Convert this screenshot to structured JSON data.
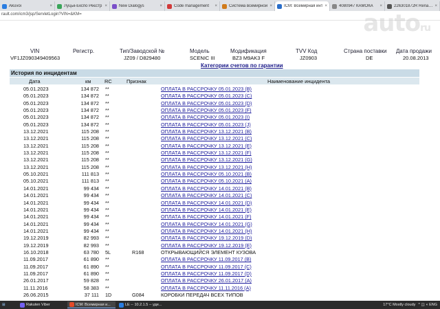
{
  "browser": {
    "tabs": [
      {
        "label": "Akuvoi",
        "color": "#2a7de1"
      },
      {
        "label": "Луцьк-Експо Реєстр",
        "color": "#3aa55a"
      },
      {
        "label": "New Dialogys",
        "color": "#7a4fc9"
      },
      {
        "label": "Code management",
        "color": "#d13a3a"
      },
      {
        "label": "Система всемирной",
        "color": "#d07a1a"
      },
      {
        "label": "ICM: Всемирная инт",
        "color": "#2a6ec9",
        "active": true
      },
      {
        "label": "4080947 КАМОКА",
        "color": "#888888"
      },
      {
        "label": "226301872R Renault",
        "color": "#555555"
      }
    ],
    "address": "rault.com/icm3/jsp/ServletLogin?VIN=&KM="
  },
  "watermark": {
    "main": "auto",
    "suffix": "ru"
  },
  "vehicle": {
    "headers": {
      "vin": "VIN",
      "reg": "Регистр.",
      "type": "Тип/Заводской №",
      "model": "Модель",
      "modification": "Модификация",
      "tvv": "TVV Код",
      "country": "Страна поставки",
      "sale_date": "Дата продажи"
    },
    "values": {
      "vin": "VF1JZ090349409563",
      "reg": "",
      "type": "JZ09 / D829480",
      "model": "SCENIC III",
      "modification": "BZ3 M9AK3 F",
      "tvv": "JZ0903",
      "country": "DE",
      "sale_date": "20.08.2013"
    }
  },
  "categories_link": "Категории счетов по гарантии",
  "history": {
    "title": "История по инцидентам",
    "columns": {
      "date": "Дата",
      "km": "км",
      "rc": "RC",
      "sign": "Признак",
      "name": "Наименование инцидента"
    },
    "rows": [
      {
        "date": "05.01.2023",
        "km": "134 872",
        "rc": "**",
        "sign": "",
        "name": "ОПЛАТА В РАССРОЧКУ 05.01.2023 (B)",
        "link": true
      },
      {
        "date": "05.01.2023",
        "km": "134 872",
        "rc": "**",
        "sign": "",
        "name": "ОПЛАТА В РАССРОЧКУ 05.01.2023 (C)",
        "link": true
      },
      {
        "date": "05.01.2023",
        "km": "134 872",
        "rc": "**",
        "sign": "",
        "name": "ОПЛАТА В РАССРОЧКУ 05.01.2023 (D)",
        "link": true
      },
      {
        "date": "05.01.2023",
        "km": "134 872",
        "rc": "**",
        "sign": "",
        "name": "ОПЛАТА В РАССРОЧКУ 05.01.2023 (F)",
        "link": true
      },
      {
        "date": "05.01.2023",
        "km": "134 872",
        "rc": "**",
        "sign": "",
        "name": "ОПЛАТА В РАССРОЧКУ 05.01.2023 (I)",
        "link": true
      },
      {
        "date": "05.01.2023",
        "km": "134 872",
        "rc": "**",
        "sign": "",
        "name": "ОПЛАТА В РАССРОЧКУ 05.01.2023 (J)",
        "link": true
      },
      {
        "date": "13.12.2021",
        "km": "115 208",
        "rc": "**",
        "sign": "",
        "name": "ОПЛАТА В РАССРОЧКУ 13.12.2021 (B)",
        "link": true
      },
      {
        "date": "13.12.2021",
        "km": "115 208",
        "rc": "**",
        "sign": "",
        "name": "ОПЛАТА В РАССРОЧКУ 13.12.2021 (C)",
        "link": true
      },
      {
        "date": "13.12.2021",
        "km": "115 208",
        "rc": "**",
        "sign": "",
        "name": "ОПЛАТА В РАССРОЧКУ 13.12.2021 (E)",
        "link": true
      },
      {
        "date": "13.12.2021",
        "km": "115 208",
        "rc": "**",
        "sign": "",
        "name": "ОПЛАТА В РАССРОЧКУ 13.12.2021 (F)",
        "link": true
      },
      {
        "date": "13.12.2021",
        "km": "115 208",
        "rc": "**",
        "sign": "",
        "name": "ОПЛАТА В РАССРОЧКУ 13.12.2021 (G)",
        "link": true
      },
      {
        "date": "13.12.2021",
        "km": "115 208",
        "rc": "**",
        "sign": "",
        "name": "ОПЛАТА В РАССРОЧКУ 13.12.2021 (H)",
        "link": true
      },
      {
        "date": "05.10.2021",
        "km": "111 813",
        "rc": "**",
        "sign": "",
        "name": "ОПЛАТА В РАССРОЧКУ 05.10.2021 (B)",
        "link": true
      },
      {
        "date": "05.10.2021",
        "km": "111 813",
        "rc": "**",
        "sign": "",
        "name": "ОПЛАТА В РАССРОЧКУ 05.10.2021 (A)",
        "link": true
      },
      {
        "date": "14.01.2021",
        "km": "99 434",
        "rc": "**",
        "sign": "",
        "name": "ОПЛАТА В РАССРОЧКУ 14.01.2021 (B)",
        "link": true
      },
      {
        "date": "14.01.2021",
        "km": "99 434",
        "rc": "**",
        "sign": "",
        "name": "ОПЛАТА В РАССРОЧКУ 14.01.2021 (C)",
        "link": true
      },
      {
        "date": "14.01.2021",
        "km": "99 434",
        "rc": "**",
        "sign": "",
        "name": "ОПЛАТА В РАССРОЧКУ 14.01.2021 (D)",
        "link": true
      },
      {
        "date": "14.01.2021",
        "km": "99 434",
        "rc": "**",
        "sign": "",
        "name": "ОПЛАТА В РАССРОЧКУ 14.01.2021 (E)",
        "link": true
      },
      {
        "date": "14.01.2021",
        "km": "99 434",
        "rc": "**",
        "sign": "",
        "name": "ОПЛАТА В РАССРОЧКУ 14.01.2021 (F)",
        "link": true
      },
      {
        "date": "14.01.2021",
        "km": "99 434",
        "rc": "**",
        "sign": "",
        "name": "ОПЛАТА В РАССРОЧКУ 14.01.2021 (G)",
        "link": true
      },
      {
        "date": "14.01.2021",
        "km": "99 434",
        "rc": "**",
        "sign": "",
        "name": "ОПЛАТА В РАССРОЧКУ 14.01.2021 (H)",
        "link": true
      },
      {
        "date": "19.12.2019",
        "km": "82 993",
        "rc": "**",
        "sign": "",
        "name": "ОПЛАТА В РАССРОЧКУ 19.12.2019 (D)",
        "link": true
      },
      {
        "date": "19.12.2019",
        "km": "82 993",
        "rc": "**",
        "sign": "",
        "name": "ОПЛАТА В РАССРОЧКУ 19.12.2019 (E)",
        "link": true
      },
      {
        "date": "16.10.2018",
        "km": "63 780",
        "rc": "5L",
        "sign": "R168",
        "name": "ОТКРЫВАЮЩИЙСЯ ЭЛЕМЕНТ КУЗОВА",
        "link": false
      },
      {
        "date": "11.09.2017",
        "km": "61 890",
        "rc": "**",
        "sign": "",
        "name": "ОПЛАТА В РАССРОЧКУ 11.09.2017 (B)",
        "link": true
      },
      {
        "date": "11.09.2017",
        "km": "61 890",
        "rc": "**",
        "sign": "",
        "name": "ОПЛАТА В РАССРОЧКУ 11.09.2017 (C)",
        "link": true
      },
      {
        "date": "11.09.2017",
        "km": "61 890",
        "rc": "**",
        "sign": "",
        "name": "ОПЛАТА В РАССРОЧКУ 11.09.2017 (D)",
        "link": true
      },
      {
        "date": "26.01.2017",
        "km": "59 828",
        "rc": "**",
        "sign": "",
        "name": "ОПЛАТА В РАССРОЧКУ 26.01.2017 (A)",
        "link": true
      },
      {
        "date": "11.11.2016",
        "km": "58 383",
        "rc": "**",
        "sign": "",
        "name": "ОПЛАТА В РАССРОЧКУ 11.11.2016 (A)",
        "link": true
      },
      {
        "date": "26.06.2015",
        "km": "37 111",
        "rc": "1D",
        "sign": "G084",
        "name": "КОРОБКИ ПЕРЕДАЧ ВСЕХ ТИПОВ",
        "link": false
      }
    ]
  },
  "taskbar": {
    "items": [
      {
        "label": "Rakuten Viber",
        "color": "#7360f2"
      },
      {
        "label": "ICM: Всемирная и...",
        "color": "#e34b2a",
        "active": true
      },
      {
        "label": "LE -- 10.2.1.5 -- уде...",
        "color": "#2a7de1"
      }
    ],
    "weather": "17°C  Mostly cloudy",
    "tray_icons": "^ ◫ ◖ ENG"
  }
}
